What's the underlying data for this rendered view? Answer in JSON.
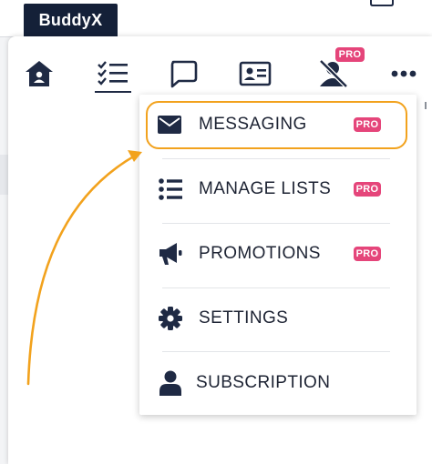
{
  "brand": {
    "name": "BuddyX"
  },
  "tabs": [
    {
      "icon": "home-icon"
    },
    {
      "icon": "task-list-icon",
      "active": true
    },
    {
      "icon": "message-icon"
    },
    {
      "icon": "id-card-icon"
    },
    {
      "icon": "user-off-icon",
      "badge": "PRO"
    },
    {
      "icon": "more-icon"
    }
  ],
  "menu": {
    "items": [
      {
        "label": "MESSAGING",
        "icon": "envelope-icon",
        "badge": "PRO",
        "highlighted": true
      },
      {
        "label": "MANAGE LISTS",
        "icon": "list-icon",
        "badge": "PRO"
      },
      {
        "label": "PROMOTIONS",
        "icon": "megaphone-icon",
        "badge": "PRO"
      },
      {
        "label": "SETTINGS",
        "icon": "gear-icon"
      },
      {
        "label": "SUBSCRIPTION",
        "icon": "user-icon"
      }
    ]
  },
  "colors": {
    "brand_bg": "#142038",
    "pro_badge": "#e5457a",
    "highlight": "#f2a21d",
    "icon": "#1f2a44"
  }
}
